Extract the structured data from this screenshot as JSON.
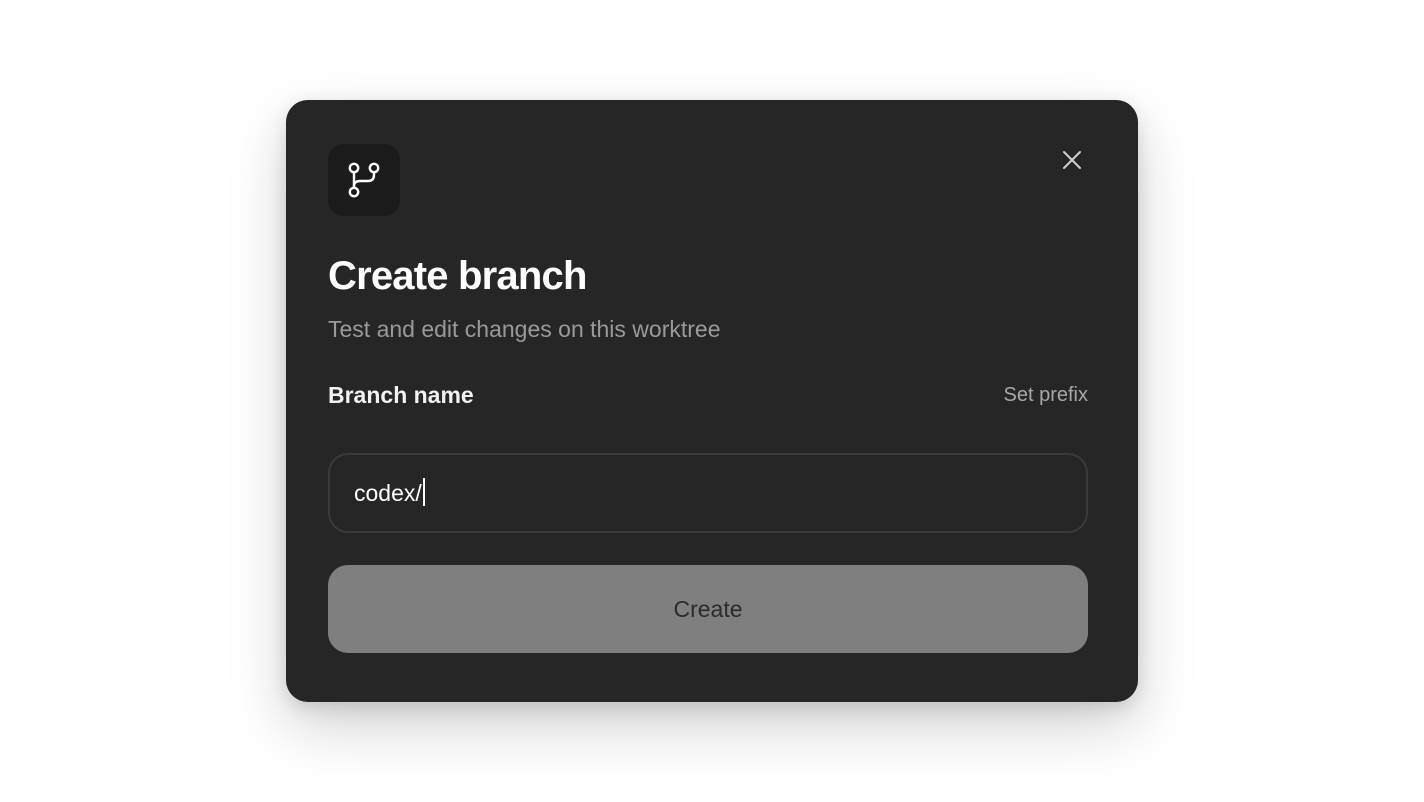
{
  "dialog": {
    "icon": "git-branch-icon",
    "close_icon": "close-icon",
    "title": "Create branch",
    "subtitle": "Test and edit changes on this worktree",
    "field_label": "Branch name",
    "set_prefix_label": "Set prefix",
    "input": {
      "value": "codex/"
    },
    "create_label": "Create"
  },
  "colors": {
    "dialog_background": "#262626",
    "icon_tile_background": "#1b1b1b",
    "create_button_disabled": "#7f7f7f",
    "subtitle_text": "#9a9a9a"
  }
}
